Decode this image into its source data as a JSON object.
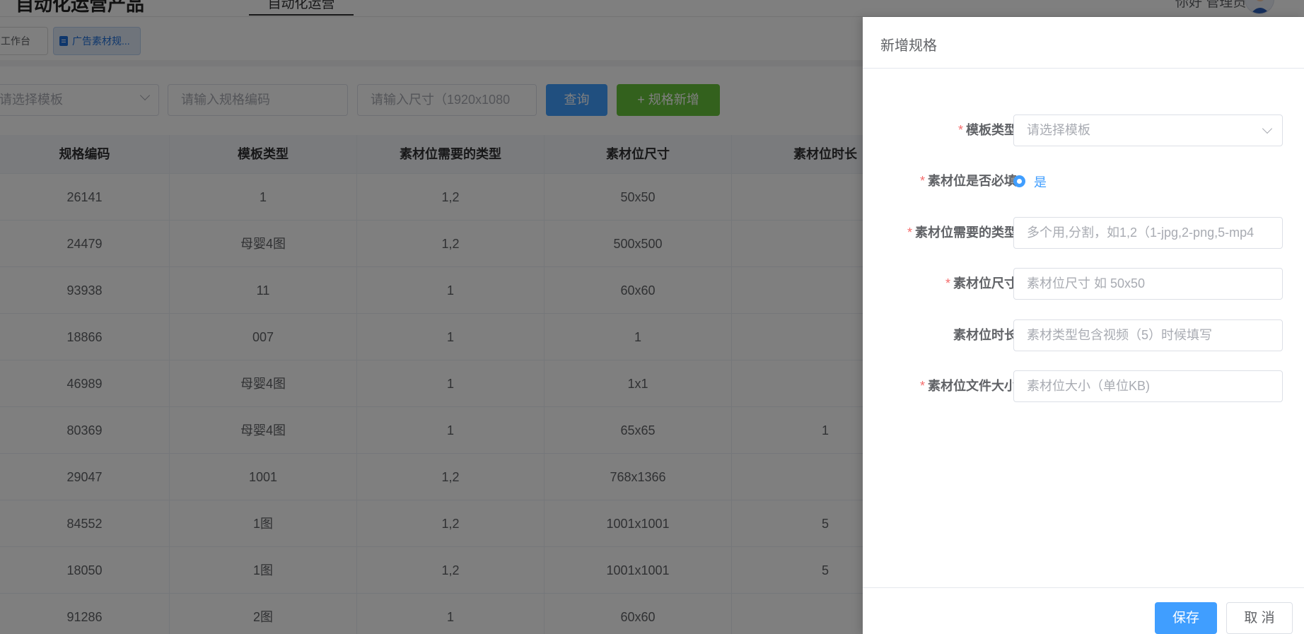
{
  "header": {
    "app_title": "自动化运营产品",
    "active_tab": "自动化运营",
    "user_name": "你好 管理员"
  },
  "tags": [
    {
      "label": "工作台"
    },
    {
      "label": "广告素材规..."
    }
  ],
  "filters": {
    "template_placeholder": "请选择模板",
    "spec_code_placeholder": "请输入规格编码",
    "size_placeholder": "请输入尺寸（1920x1080",
    "query_label": "查询",
    "add_label": "+ 规格新增"
  },
  "table": {
    "columns": [
      "规格编码",
      "模板类型",
      "素材位需要的类型",
      "素材位尺寸",
      "素材位时长"
    ],
    "rows": [
      [
        "26141",
        "1",
        "1,2",
        "50x50",
        ""
      ],
      [
        "24479",
        "母婴4图",
        "1,2",
        "500x500",
        ""
      ],
      [
        "93938",
        "11",
        "1",
        "60x60",
        ""
      ],
      [
        "18866",
        "007",
        "1",
        "1",
        ""
      ],
      [
        "46989",
        "母婴4图",
        "1",
        "1x1",
        ""
      ],
      [
        "80369",
        "母婴4图",
        "1",
        "65x65",
        "1"
      ],
      [
        "29047",
        "1001",
        "1,2",
        "768x1366",
        ""
      ],
      [
        "84552",
        "1图",
        "1,2",
        "1001x1001",
        "5"
      ],
      [
        "18050",
        "1图",
        "1,2",
        "1001x1001",
        "5"
      ],
      [
        "91286",
        "2图",
        "1",
        "60x60",
        ""
      ]
    ]
  },
  "drawer": {
    "title": "新增规格",
    "fields": [
      {
        "label": "模板类型",
        "required": true,
        "type": "select",
        "placeholder": "请选择模板"
      },
      {
        "label": "素材位是否必填",
        "required": true,
        "type": "radio",
        "value": "是"
      },
      {
        "label": "素材位需要的类型",
        "required": true,
        "type": "input",
        "placeholder": "多个用,分割，如1,2（1-jpg,2-png,5-mp4"
      },
      {
        "label": "素材位尺寸",
        "required": true,
        "type": "input",
        "placeholder": "素材位尺寸  如 50x50"
      },
      {
        "label": "素材位时长",
        "required": false,
        "type": "input",
        "placeholder": "素材类型包含视频（5）时候填写"
      },
      {
        "label": "素材位文件大小",
        "required": true,
        "type": "input",
        "placeholder": "素材位大小（单位KB)"
      }
    ],
    "save_label": "保存",
    "cancel_label": "取 消"
  },
  "colors": {
    "primary": "#409eff",
    "success": "#67c23a",
    "danger": "#f56c6c"
  }
}
